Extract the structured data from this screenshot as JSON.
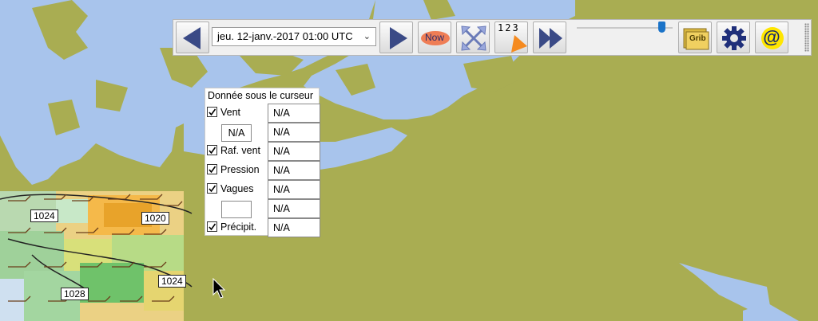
{
  "toolbar": {
    "date_value": "jeu. 12-janv.-2017 01:00  UTC",
    "now_label": "Now",
    "counter_label": "123",
    "grib_label": "Grib",
    "email_label": "@",
    "slider_level": 0.9
  },
  "data_panel": {
    "title": "Donnée sous le curseur",
    "rows": [
      {
        "label": "Vent",
        "checked": true,
        "value": "N/A"
      },
      {
        "label": "",
        "sub_value": "N/A",
        "value": "N/A"
      },
      {
        "label": "Raf. vent",
        "checked": true,
        "value": "N/A"
      },
      {
        "label": "Pression",
        "checked": true,
        "value": "N/A"
      },
      {
        "label": "Vagues",
        "checked": true,
        "value": "N/A"
      },
      {
        "label": "",
        "sub_value": "",
        "value": "N/A"
      },
      {
        "label": "Précipit.",
        "checked": true,
        "value": "N/A"
      }
    ]
  },
  "isobars": [
    "1024",
    "1020",
    "1024",
    "1028"
  ],
  "colors": {
    "land": "#a9ad52",
    "sea": "#a8c4ec",
    "toolbar_bg": "#f0f0f0",
    "slider_thumb": "#1a73c8",
    "now_badge": "#ef7d55",
    "counter_triangle": "#f58a1f"
  }
}
